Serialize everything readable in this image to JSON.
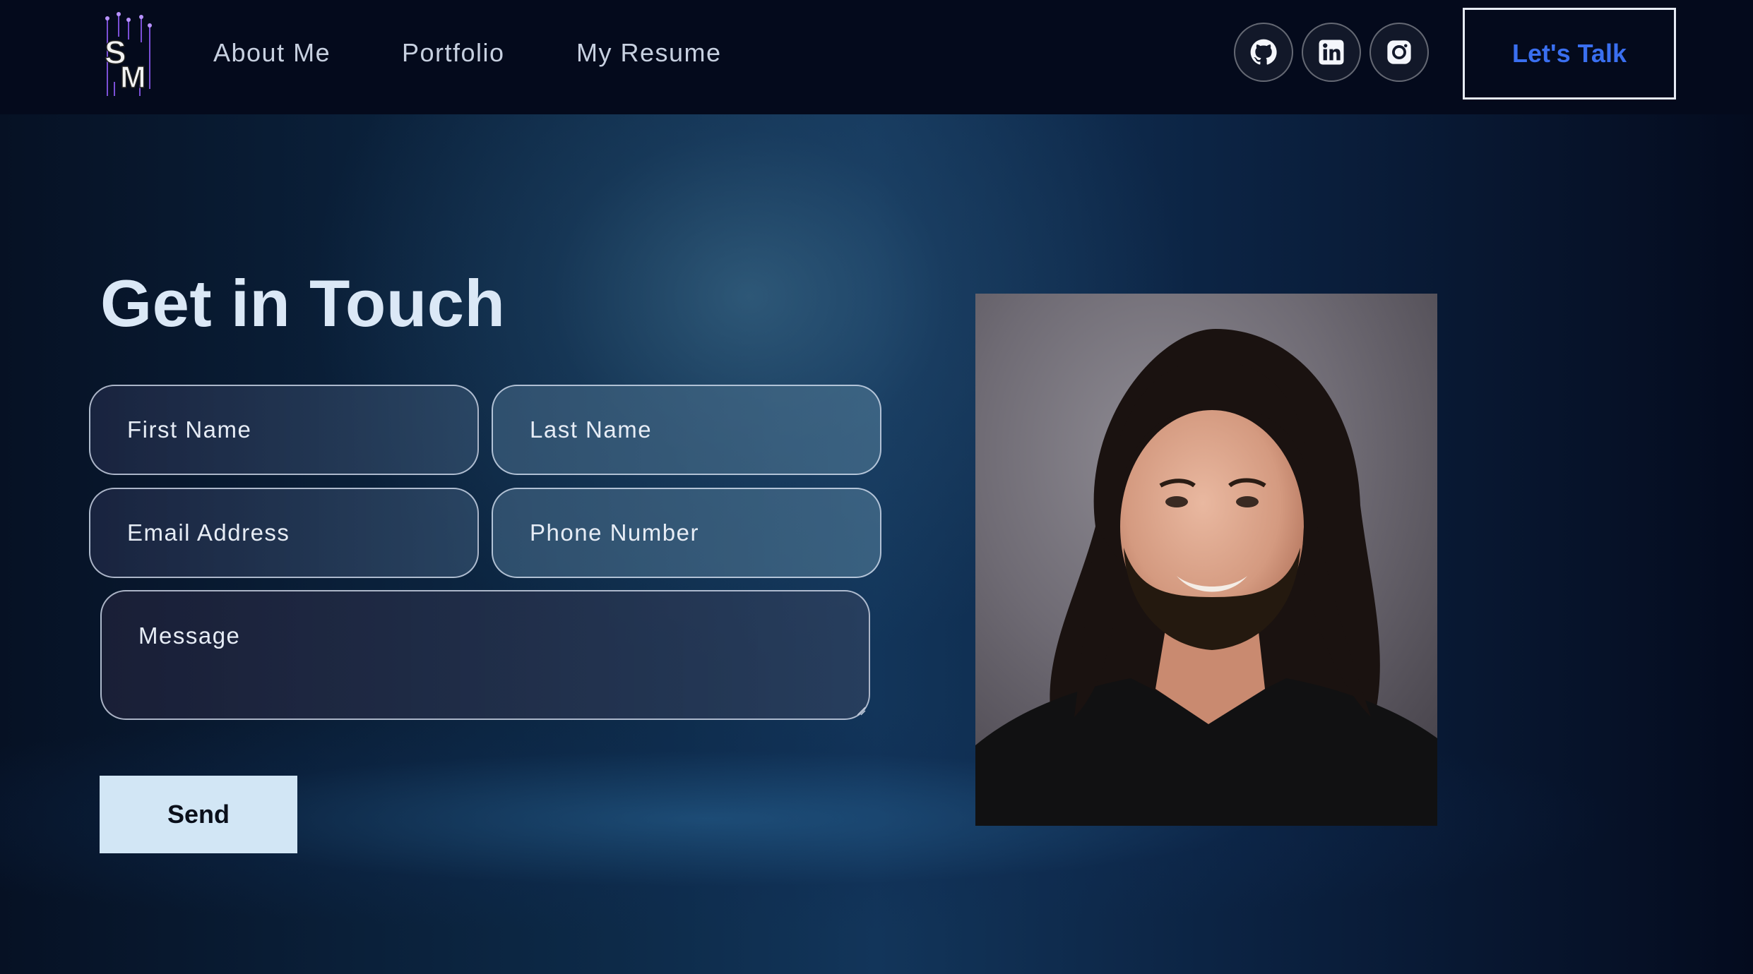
{
  "nav": {
    "links": [
      "About Me",
      "Portfolio",
      "My Resume"
    ],
    "social_icons": [
      "github-icon",
      "linkedin-icon",
      "instagram-icon"
    ],
    "cta_label": "Let's Talk"
  },
  "contact": {
    "title": "Get in Touch",
    "fields": {
      "first_name": "First Name",
      "last_name": "Last Name",
      "email": "Email Address",
      "phone": "Phone Number",
      "message": "Message"
    },
    "send_label": "Send"
  },
  "colors": {
    "header_bg": "#040a1c",
    "accent": "#3a6ff0",
    "send_button_bg": "#d2e6f5",
    "title_text": "#dbe8f6"
  }
}
